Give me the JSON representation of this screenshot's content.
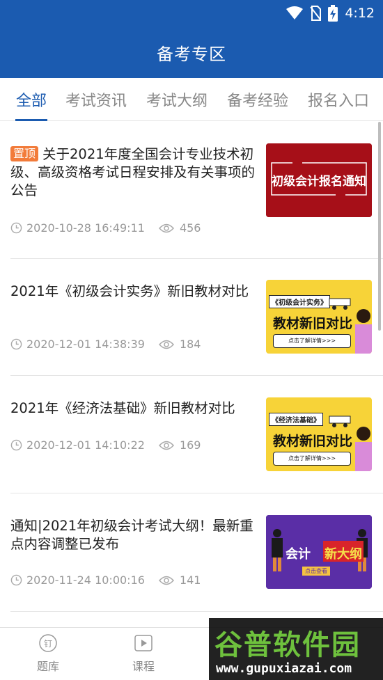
{
  "status_bar": {
    "time": "4:12",
    "icons": [
      "wifi-icon",
      "no-sim-icon",
      "battery-charging-icon"
    ]
  },
  "header": {
    "title": "备考专区"
  },
  "tabs": [
    {
      "label": "全部",
      "active": true
    },
    {
      "label": "考试资讯",
      "active": false
    },
    {
      "label": "考试大纲",
      "active": false
    },
    {
      "label": "备考经验",
      "active": false
    },
    {
      "label": "报名入口",
      "active": false
    }
  ],
  "articles": [
    {
      "pin": "置顶",
      "title": "关于2021年度全国会计专业技术初级、高级资格考试日程安排及有关事项的公告",
      "date": "2020-10-28 16:49:11",
      "views": "456",
      "thumb": {
        "text": "初级会计报名通知",
        "bg": "#b3121a"
      }
    },
    {
      "title": "2021年《初级会计实务》新旧教材对比",
      "date": "2020-12-01 14:38:39",
      "views": "184",
      "thumb": {
        "tag": "《初级会计实务》",
        "headline": "教材新旧对比",
        "cta": "点击了解详情>>>",
        "bg": "#f7d338"
      }
    },
    {
      "title": "2021年《经济法基础》新旧教材对比",
      "date": "2020-12-01 14:10:22",
      "views": "169",
      "thumb": {
        "tag": "《经济法基础》",
        "headline": "教材新旧对比",
        "cta": "点击了解详情>>>",
        "bg": "#f7d338"
      }
    },
    {
      "title": "通知|2021年初级会计考试大纲！最新重点内容调整已发布",
      "date": "2020-11-24 10:00:16",
      "views": "141",
      "thumb": {
        "text1": "会计",
        "text2": "新大纲",
        "cta": "点击查看",
        "bg": "#5a2ea6"
      }
    }
  ],
  "bottom_nav": [
    {
      "label": "题库",
      "icon": "nail-icon"
    },
    {
      "label": "课程",
      "icon": "play-icon"
    }
  ],
  "watermark": {
    "name": "谷普软件园",
    "url": "www.gupuxiazai.com"
  }
}
